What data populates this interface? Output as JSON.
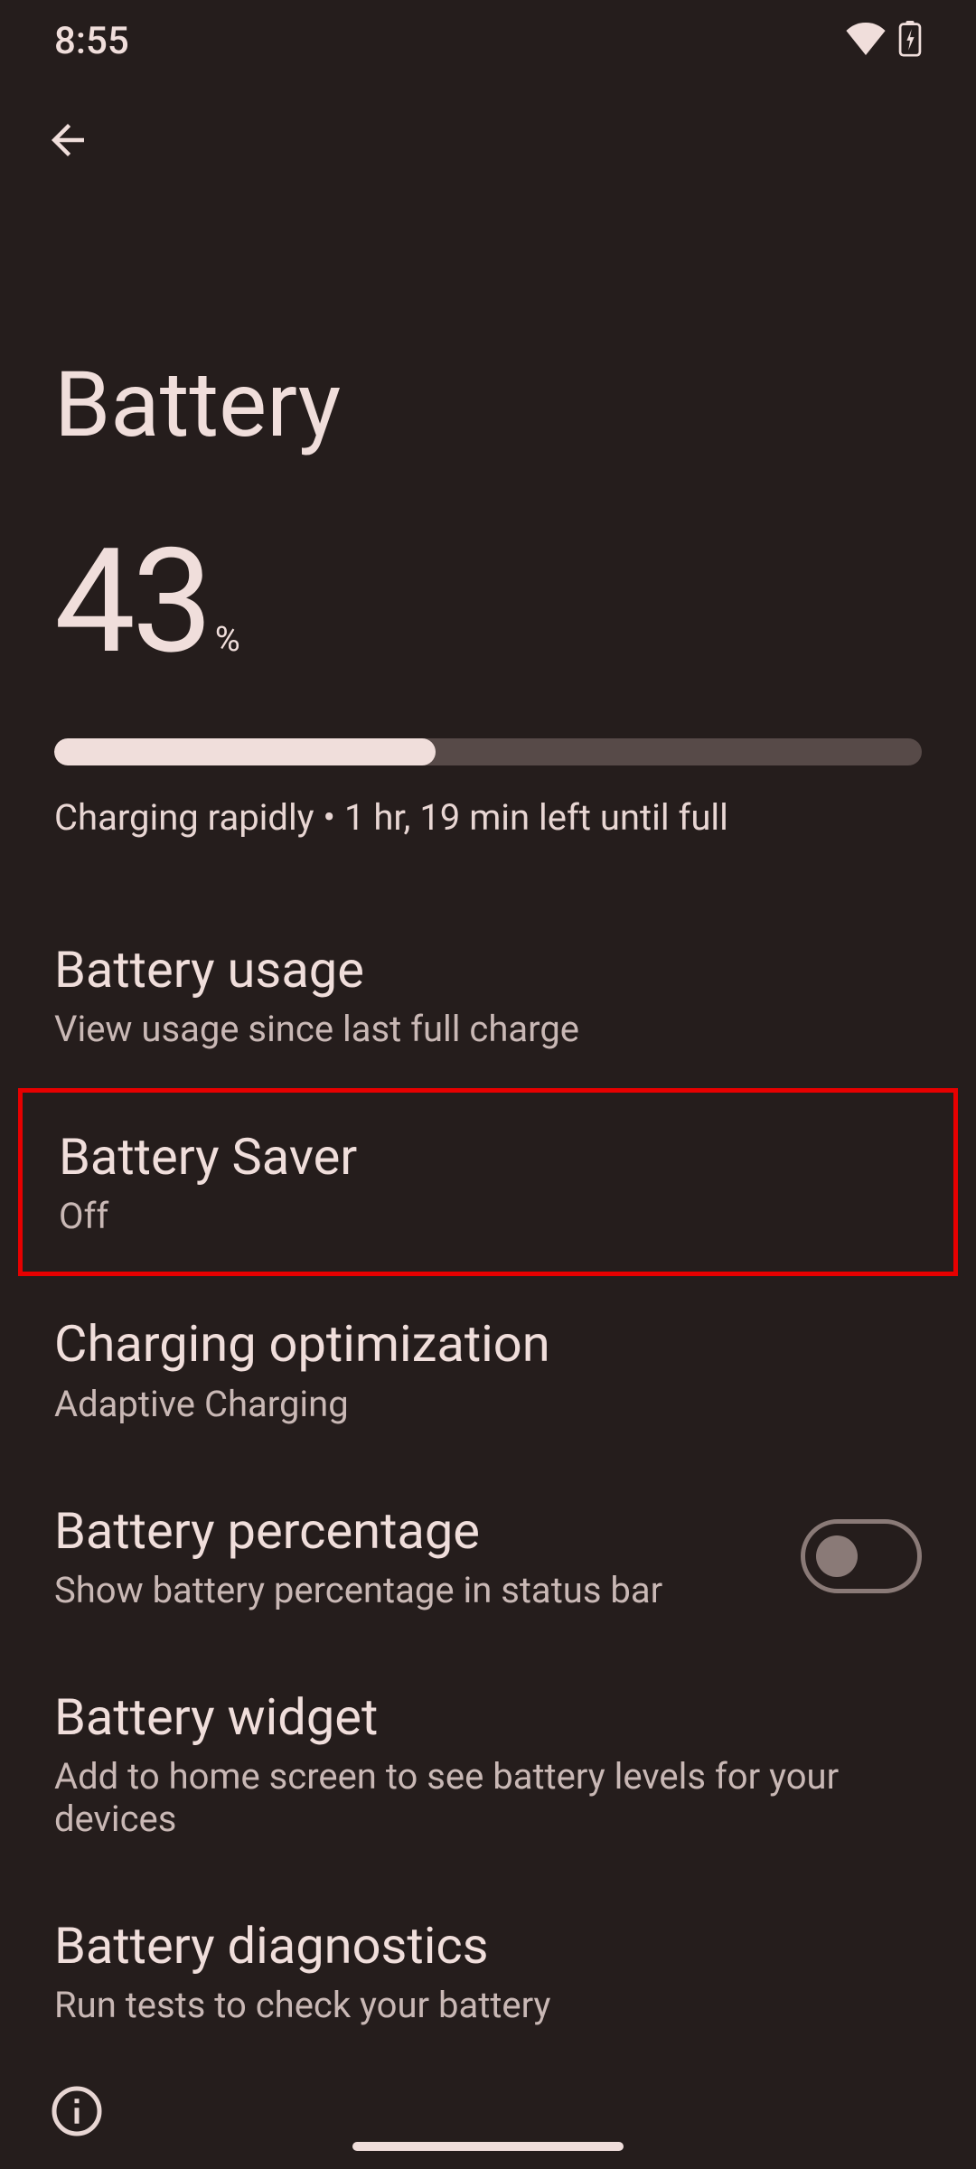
{
  "status_bar": {
    "time": "8:55"
  },
  "header": {
    "title": "Battery"
  },
  "battery": {
    "level": "43",
    "percent_sign": "%",
    "status": "Charging rapidly • 1 hr, 19 min left until full",
    "progress_percent": 44
  },
  "items": [
    {
      "title": "Battery usage",
      "subtitle": "View usage since last full charge"
    },
    {
      "title": "Battery Saver",
      "subtitle": "Off"
    },
    {
      "title": "Charging optimization",
      "subtitle": "Adaptive Charging"
    },
    {
      "title": "Battery percentage",
      "subtitle": "Show battery percentage in status bar",
      "toggle": false
    },
    {
      "title": "Battery widget",
      "subtitle": "Add to home screen to see battery levels for your devices"
    },
    {
      "title": "Battery diagnostics",
      "subtitle": "Run tests to check your battery"
    }
  ]
}
